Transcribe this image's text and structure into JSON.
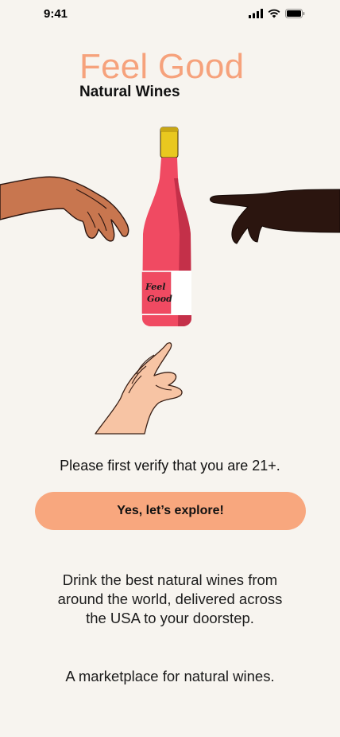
{
  "status_bar": {
    "time": "9:41",
    "icons": [
      "signal-icon",
      "wifi-icon",
      "battery-icon"
    ]
  },
  "brand": {
    "title": "Feel Good",
    "subtitle": "Natural Wines",
    "accent_color": "#f6a27c"
  },
  "hero": {
    "bottle_label_line1": "Feel",
    "bottle_label_line2": "Good"
  },
  "verify": {
    "text": "Please first verify that you are 21+.",
    "button_label": "Yes, let’s explore!",
    "button_color": "#f8a77e"
  },
  "description": {
    "tagline": "Drink the best natural wines from around the world, delivered across the USA to your doorstep.",
    "marketplace": "A marketplace for natural wines."
  }
}
